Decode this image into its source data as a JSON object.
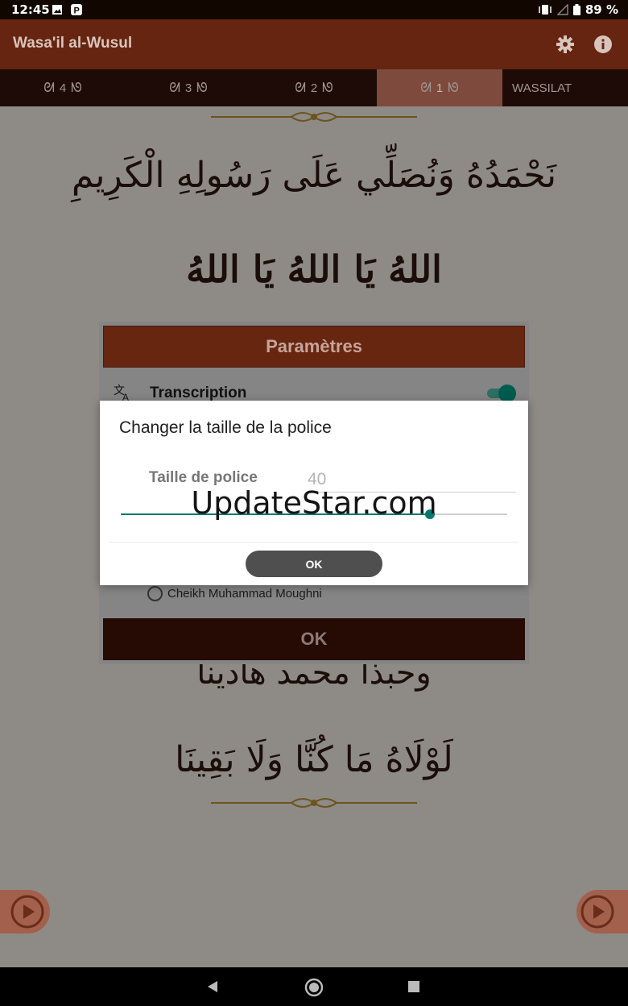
{
  "status_bar": {
    "time": "12:45",
    "battery": "89 %",
    "icons": [
      "gallery-icon",
      "parking-icon",
      "vibrate-icon",
      "signal-icon",
      "battery-icon"
    ]
  },
  "app_bar": {
    "title": "Wasa'il al-Wusul",
    "icons": [
      "gear-icon",
      "info-icon"
    ]
  },
  "tabs": [
    {
      "label": "4",
      "active": false
    },
    {
      "label": "3",
      "active": false
    },
    {
      "label": "2",
      "active": false
    },
    {
      "label": "1",
      "active": true
    },
    {
      "label": "WASSILAT",
      "active": false
    }
  ],
  "poem": {
    "verses": [
      "نَحْمَدُهُ وَنُصَلِّي عَلَى رَسُولِهِ الْكَرِيمِ",
      "اللهُ يَا اللهُ يَا اللهُ",
      "وحبذا محمد هاديناَ",
      "لَوْلَاهُ مَا كُنَّا وَلَا بَقِينَا"
    ]
  },
  "settings_dialog": {
    "title": "Paramètres",
    "transcription_label": "Transcription",
    "transcription_enabled": true,
    "reciter_option": "Cheikh Muhammad Moughni",
    "ok_label": "OK"
  },
  "font_dialog": {
    "title": "Changer la taille de la police",
    "field_label": "Taille de police",
    "field_value": "40",
    "slider_fraction": 0.8,
    "ok_label": "OK"
  },
  "watermark": "UpdateStar.com",
  "colors": {
    "app_bar": "#652510",
    "tabs": "#1e0a07",
    "accent_teal": "#00796b",
    "dialog_header": "#672610"
  }
}
